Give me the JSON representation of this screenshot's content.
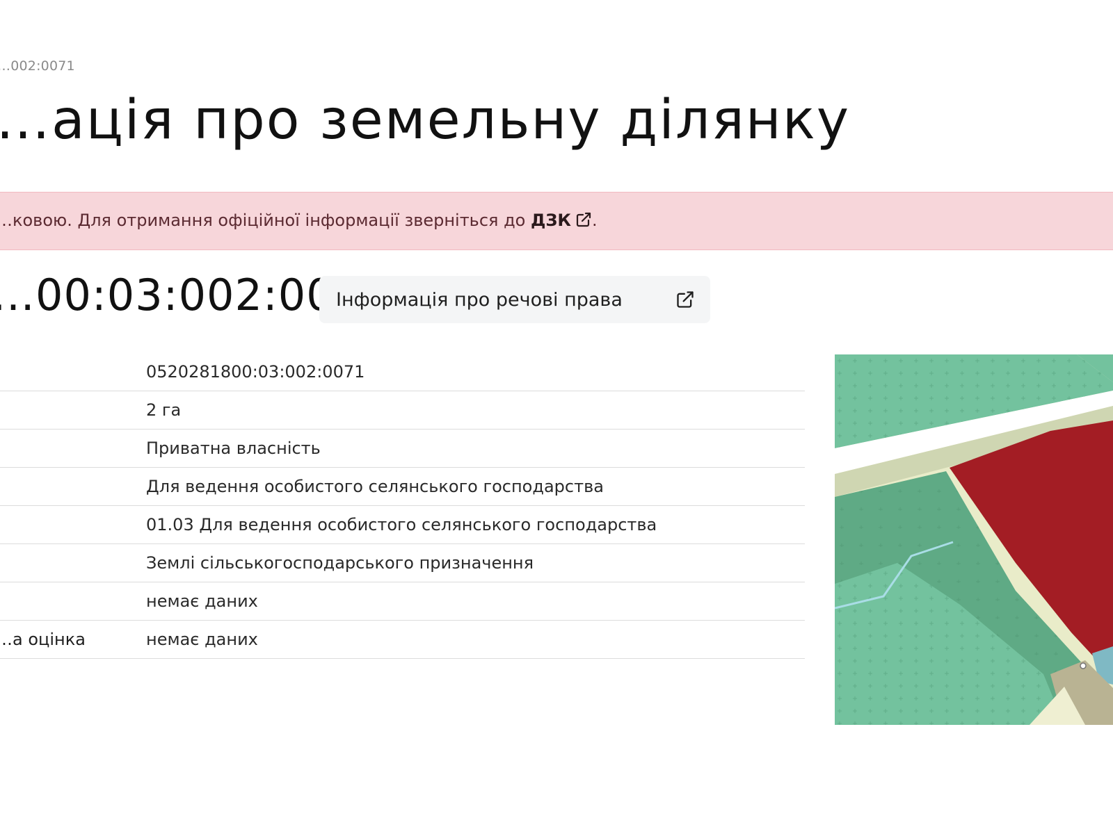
{
  "breadcrumb": {
    "current": "…002:0071"
  },
  "page": {
    "title": "…ація про земельну ділянку"
  },
  "notice": {
    "text": "…ковою. Для отримання офіційної інформації зверніться до ",
    "link_label": "ДЗК",
    "suffix": ".",
    "icon": "external-link-icon"
  },
  "parcel": {
    "cadastral_title": "…00:03:002:0071",
    "rights_button_label": "Інформація про речові права",
    "rights_button_icon": "external-link-icon"
  },
  "details": {
    "rows": [
      {
        "label": "",
        "value": "0520281800:03:002:0071"
      },
      {
        "label": "",
        "value": "2 га"
      },
      {
        "label": "",
        "value": "Приватна власність"
      },
      {
        "label": "",
        "value": "Для ведення особистого селянського господарства"
      },
      {
        "label": "",
        "value": "01.03 Для ведення особистого селянського господарства"
      },
      {
        "label": "",
        "value": "Землі сільськогосподарського призначення"
      },
      {
        "label": "",
        "value": "немає даних"
      },
      {
        "label": "…а оцінка",
        "value": "немає даних"
      }
    ]
  },
  "map": {
    "colors": {
      "selected_parcel": "#a31d24",
      "agricultural": "#73c29e",
      "forest": "#5faa85",
      "road": "#ffffff",
      "road_edge": "#cfd6b2",
      "water": "#7fb9c4",
      "bare": "#e9ecc9"
    }
  }
}
